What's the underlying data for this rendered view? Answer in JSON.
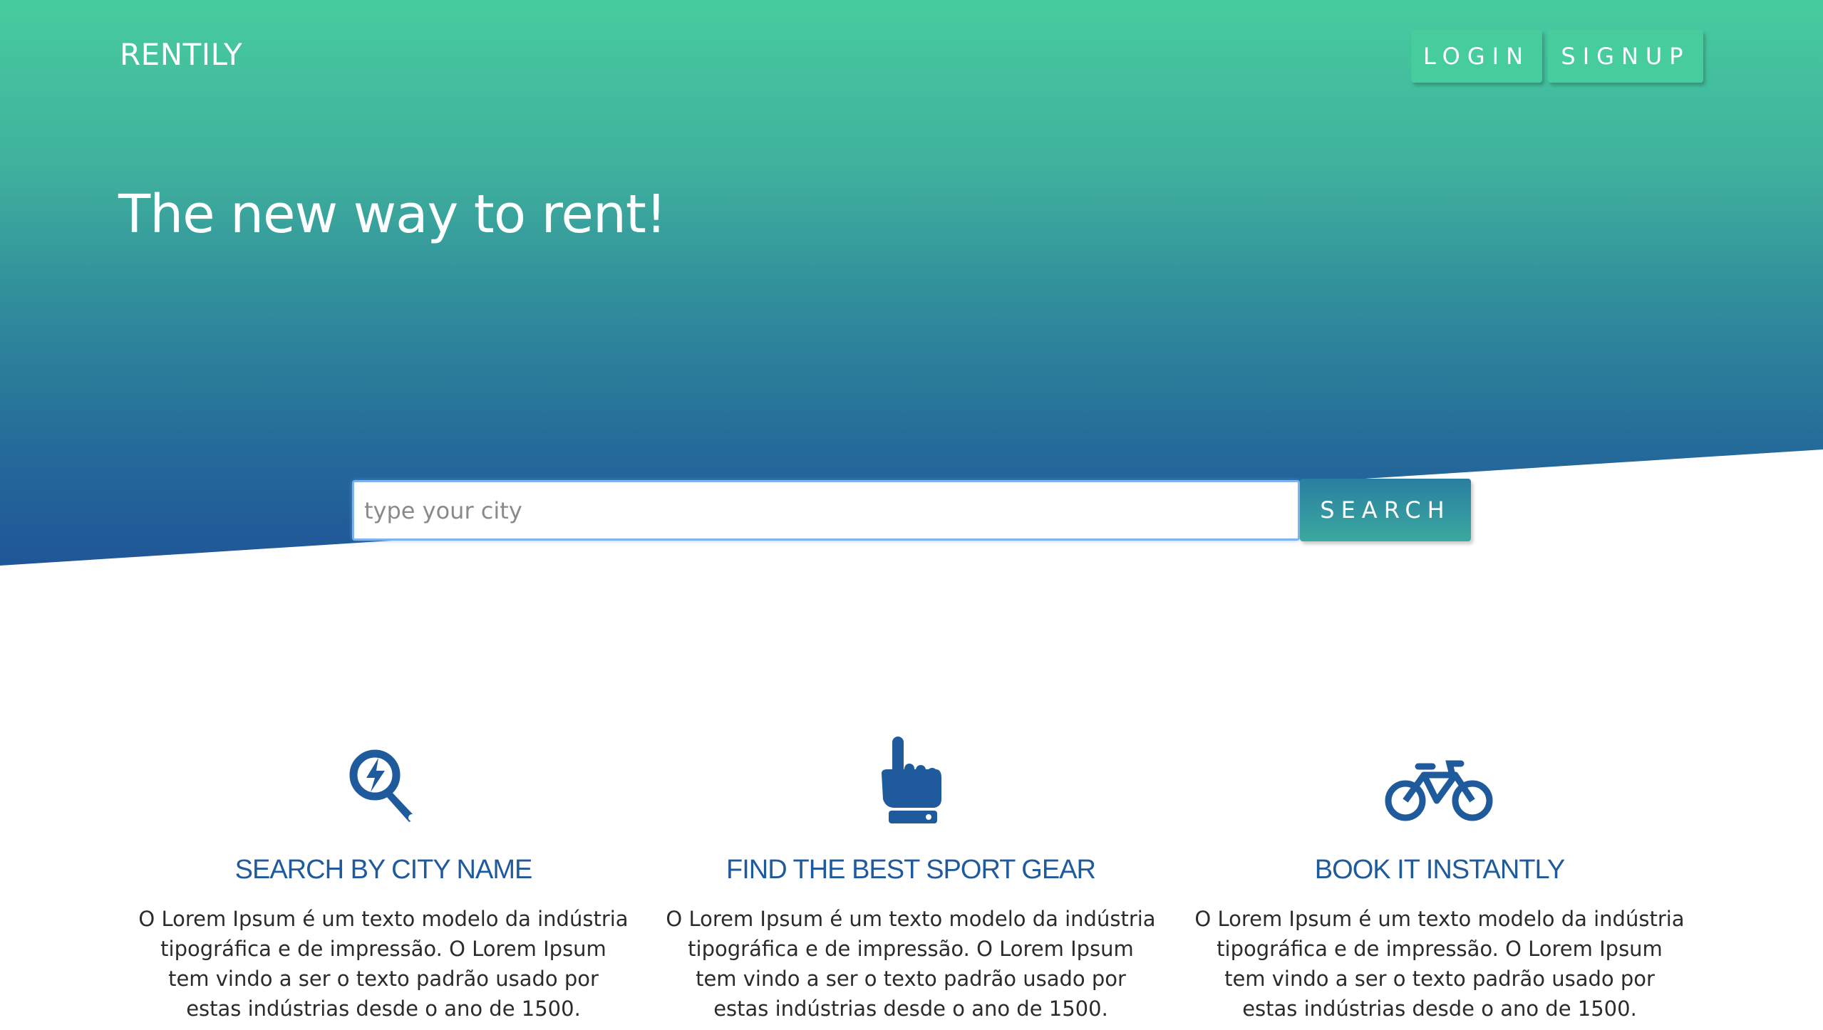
{
  "brand": "RENTILY",
  "nav": {
    "login": "LOGIN",
    "signup": "SIGNUP"
  },
  "hero": {
    "tagline": "The new way to rent!"
  },
  "search": {
    "placeholder": "type your city",
    "button": "SEARCH"
  },
  "features": [
    {
      "icon": "search-lightning-icon",
      "title": "SEARCH BY CITY NAME",
      "text": "O Lorem Ipsum é um texto modelo da indústria tipográfica e de impressão. O Lorem Ipsum tem vindo a ser o texto padrão usado por estas indústrias desde o ano de 1500."
    },
    {
      "icon": "pointing-hand-icon",
      "title": "FIND THE BEST SPORT GEAR",
      "text": "O Lorem Ipsum é um texto modelo da indústria tipográfica e de impressão. O Lorem Ipsum tem vindo a ser o texto padrão usado por estas indústrias desde o ano de 1500."
    },
    {
      "icon": "bicycle-icon",
      "title": "BOOK IT INSTANTLY",
      "text": "O Lorem Ipsum é um texto modelo da indústria tipográfica e de impressão. O Lorem Ipsum tem vindo a ser o texto padrão usado por estas indústrias desde o ano de 1500."
    }
  ],
  "colors": {
    "accent_green": "#47cc9e",
    "accent_blue": "#1f5597",
    "feature_title": "#1f5a9c"
  }
}
